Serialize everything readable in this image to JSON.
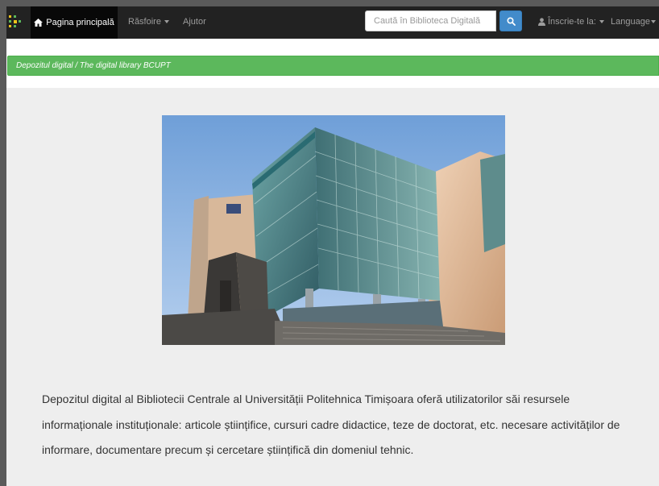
{
  "navbar": {
    "logo_icon": "bcupt-dots-logo-icon",
    "home_label": "Pagina principală",
    "home_icon": "home-icon",
    "browse_label": "Răsfoire",
    "help_label": "Ajutor",
    "search_placeholder": "Caută în Biblioteca Digitală",
    "search_icon": "search-icon",
    "login_label": "Înscrie-te la:",
    "user_icon": "user-icon",
    "language_label": "Language"
  },
  "breadcrumb": {
    "text": "Depozitul digital / The digital library BCUPT"
  },
  "main": {
    "image_subject": "library-building-photo",
    "description": "Depozitul digital al Bibliotecii Centrale al Universității Politehnica Timișoara oferă utilizatorilor săi resursele informaționale instituționale: articole științifice, cursuri cadre didactice, teze de doctorat, etc. necesare activităților de informare, documentare precum și cercetare științifică din domeniul tehnic."
  },
  "colors": {
    "navbar_bg": "#222222",
    "navbar_active_bg": "#080808",
    "breadcrumb_bg": "#5cb85c",
    "search_button_bg": "#428bca",
    "content_bg": "#eeeeee",
    "text": "#333333"
  }
}
